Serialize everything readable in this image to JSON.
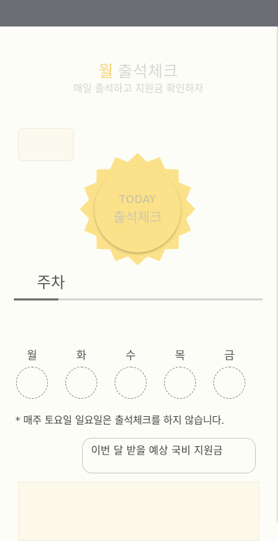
{
  "header": {
    "month": "월",
    "title": "출석체크",
    "subtitle": "매일 출석하고 지원금 확인하자"
  },
  "stamp": {
    "today": "TODAY",
    "label": "출석체크"
  },
  "week": {
    "label": "주차",
    "progress_percent": 18
  },
  "days": [
    {
      "name": "월",
      "checked": false
    },
    {
      "name": "화",
      "checked": false
    },
    {
      "name": "수",
      "checked": false
    },
    {
      "name": "목",
      "checked": false
    },
    {
      "name": "금",
      "checked": false
    }
  ],
  "notice": "* 매주 토요일 일요일은 출석체크를 하지 않습니다.",
  "subsidy_button": {
    "label": "이번 달 받을  예상 국비 지원금"
  },
  "colors": {
    "status_bar": "#6b6e75",
    "stamp_fill": "#fbe189",
    "accent_month": "#f3d57a",
    "progress_fill": "#6f6f6f"
  }
}
